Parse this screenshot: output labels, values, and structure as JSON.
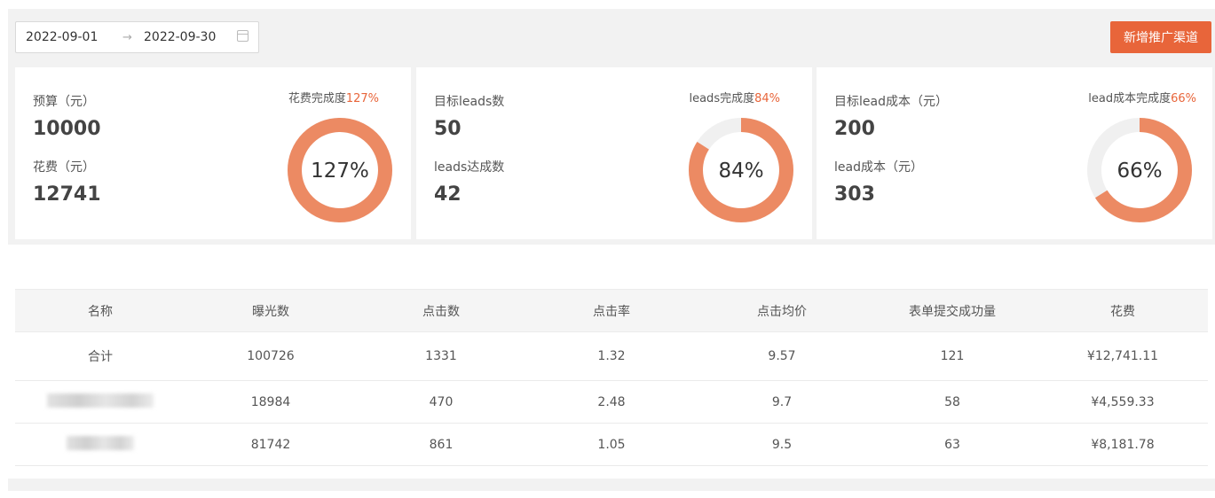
{
  "date_range": {
    "start": "2022-09-01",
    "arrow": "→",
    "end": "2022-09-30"
  },
  "toolbar": {
    "add_channel_label": "新增推广渠道"
  },
  "colors": {
    "accent": "#e8653a",
    "ring_track": "#f0f0f0"
  },
  "cards": [
    {
      "label1": "预算（元）",
      "value1": "10000",
      "label2": "花费（元）",
      "value2": "12741",
      "ring_title": "花费完成度",
      "ring_pct_text": "127%",
      "ring_center": "127%",
      "ring_fraction": 1.0
    },
    {
      "label1": "目标leads数",
      "value1": "50",
      "label2": "leads达成数",
      "value2": "42",
      "ring_title": "leads完成度",
      "ring_pct_text": "84%",
      "ring_center": "84%",
      "ring_fraction": 0.84
    },
    {
      "label1": "目标lead成本（元）",
      "value1": "200",
      "label2": "lead成本（元）",
      "value2": "303",
      "ring_title": "lead成本完成度",
      "ring_pct_text": "66%",
      "ring_center": "66%",
      "ring_fraction": 0.66
    }
  ],
  "table": {
    "columns": [
      "名称",
      "曝光数",
      "点击数",
      "点击率",
      "点击均价",
      "表单提交成功量",
      "花费"
    ],
    "rows": [
      [
        "合计",
        "100726",
        "1331",
        "1.32",
        "9.57",
        "121",
        "¥12,741.11"
      ],
      [
        "",
        "18984",
        "470",
        "2.48",
        "9.7",
        "58",
        "¥4,559.33"
      ],
      [
        "",
        "81742",
        "861",
        "1.05",
        "9.5",
        "63",
        "¥8,181.78"
      ]
    ]
  }
}
